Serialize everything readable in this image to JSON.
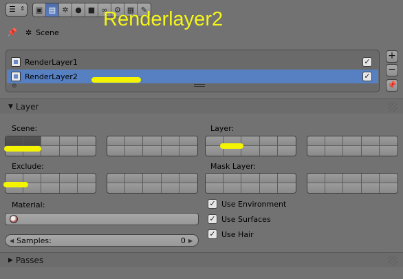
{
  "annotation": "Renderlayer2",
  "header": {
    "tabs": [
      {
        "icon": "camera-icon"
      },
      {
        "icon": "render-layers-icon"
      },
      {
        "icon": "scene-icon"
      },
      {
        "icon": "world-icon"
      },
      {
        "icon": "object-icon"
      },
      {
        "icon": "constraints-icon"
      },
      {
        "icon": "modifiers-icon"
      },
      {
        "icon": "texture-icon"
      },
      {
        "icon": "particles-icon"
      }
    ]
  },
  "context": {
    "label": "Scene"
  },
  "render_layers": [
    {
      "name": "RenderLayer1",
      "enabled": true,
      "selected": false
    },
    {
      "name": "RenderLayer2",
      "enabled": true,
      "selected": true
    }
  ],
  "layer_panel": {
    "title": "Layer",
    "scene_label": "Scene:",
    "layer_label": "Layer:",
    "exclude_label": "Exclude:",
    "mask_layer_label": "Mask Layer:",
    "material_label": "Material:",
    "samples_label": "Samples:",
    "samples_value": "0",
    "use_environment": "Use Environment",
    "use_surfaces": "Use Surfaces",
    "use_hair": "Use Hair"
  },
  "passes_panel": {
    "title": "Passes"
  }
}
